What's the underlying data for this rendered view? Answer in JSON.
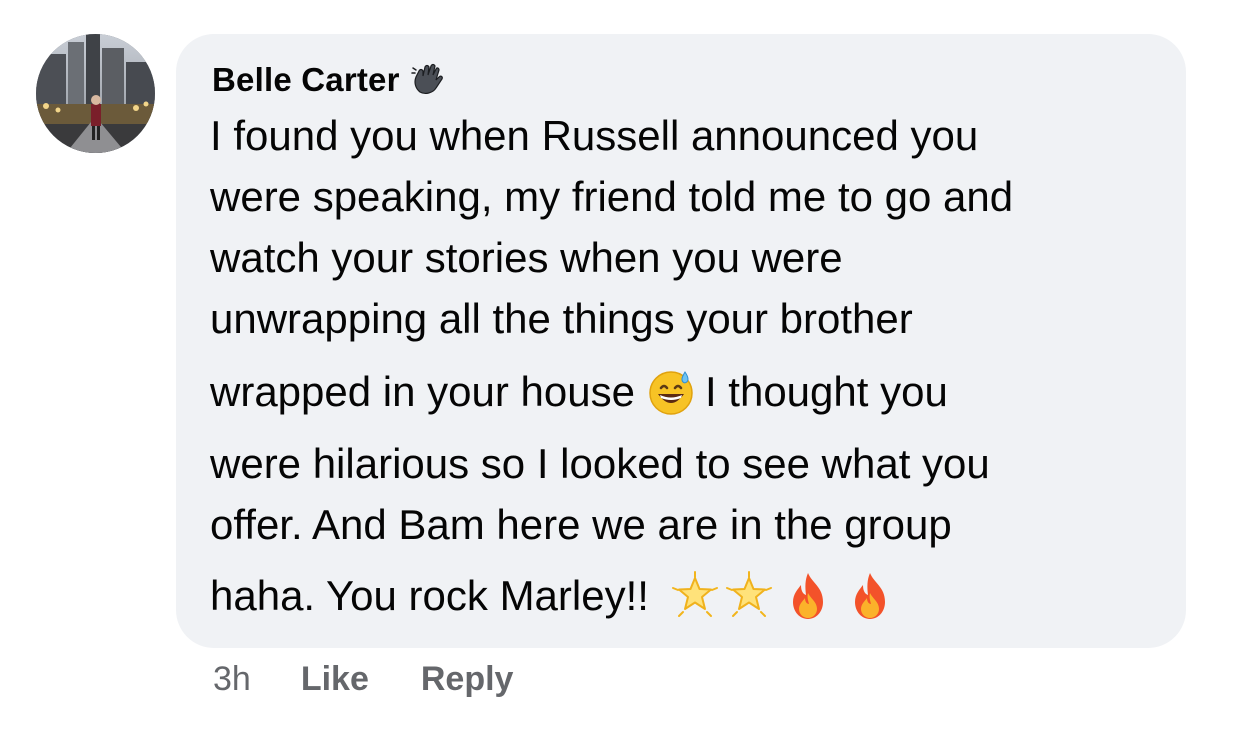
{
  "comment": {
    "author": "Belle Carter",
    "author_badge_icon": "waving-hand-icon",
    "lines": [
      "I found you when Russell announced you",
      "were speaking, my friend told me to go and",
      "watch your stories when you were",
      "unwrapping all the things your brother",
      "wrapped in your house",
      "I thought you",
      "were hilarious so I looked to see what you",
      "offer. And Bam here we are in the group",
      "haha. You rock Marley!!"
    ],
    "emojis": {
      "inline": "grinning-sweat-emoji",
      "trailing": [
        "glowing-star-emoji",
        "glowing-star-emoji",
        "fire-emoji",
        "fire-emoji"
      ]
    },
    "bubble_color": "#f0f2f5"
  },
  "actions": {
    "timestamp": "3h",
    "like_label": "Like",
    "reply_label": "Reply",
    "color": "#65676b"
  }
}
